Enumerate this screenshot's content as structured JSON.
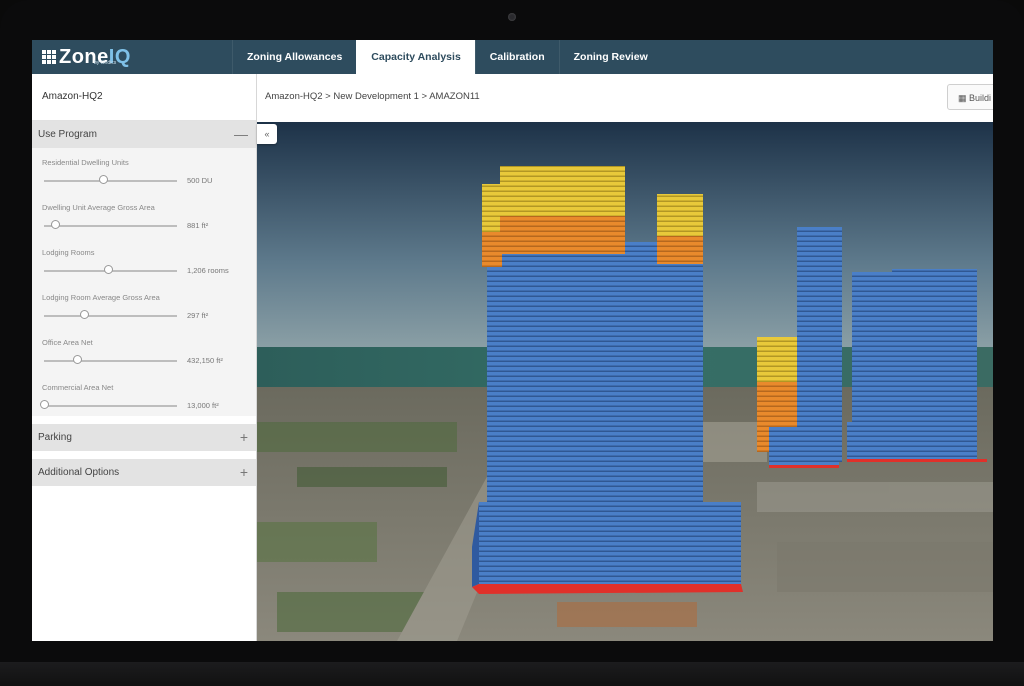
{
  "app": {
    "logo_main": "Zone",
    "logo_iq": "IQ",
    "logo_sub": "by Gridics"
  },
  "nav": {
    "tabs": [
      {
        "label": "Zoning Allowances",
        "active": false
      },
      {
        "label": "Capacity Analysis",
        "active": true
      },
      {
        "label": "Calibration",
        "active": false
      },
      {
        "label": "Zoning Review",
        "active": false
      }
    ]
  },
  "sidebar": {
    "project": "Amazon-HQ2",
    "use_program": {
      "title": "Use Program",
      "toggle": "—",
      "fields": [
        {
          "label": "Residential Dwelling Units",
          "value": "500 DU",
          "level": 0.44
        },
        {
          "label": "Dwelling Unit Average Gross Area",
          "value": "881 ft²",
          "level": 0.08
        },
        {
          "label": "Lodging Rooms",
          "value": "1,206 rooms",
          "level": 0.48
        },
        {
          "label": "Lodging Room Average Gross Area",
          "value": "297 ft²",
          "level": 0.3
        },
        {
          "label": "Office Area Net",
          "value": "432,150 ft²",
          "level": 0.25
        },
        {
          "label": "Commercial Area Net",
          "value": "13,000 ft²",
          "level": 0.0
        }
      ]
    },
    "parking": {
      "title": "Parking",
      "toggle": "+"
    },
    "additional": {
      "title": "Additional Options",
      "toggle": "+"
    }
  },
  "content": {
    "breadcrumb": "Amazon-HQ2 > New Development 1 > AMAZON11",
    "build_button": "Buildi",
    "collapse_icon": "double-chevron-icon",
    "collapse_glyph": "«"
  },
  "colors": {
    "nav": "#2e4c5e",
    "residential": "#e8c93a",
    "lodging": "#e98a2c",
    "office": "#4a7fc8",
    "base": "#e0302a"
  }
}
